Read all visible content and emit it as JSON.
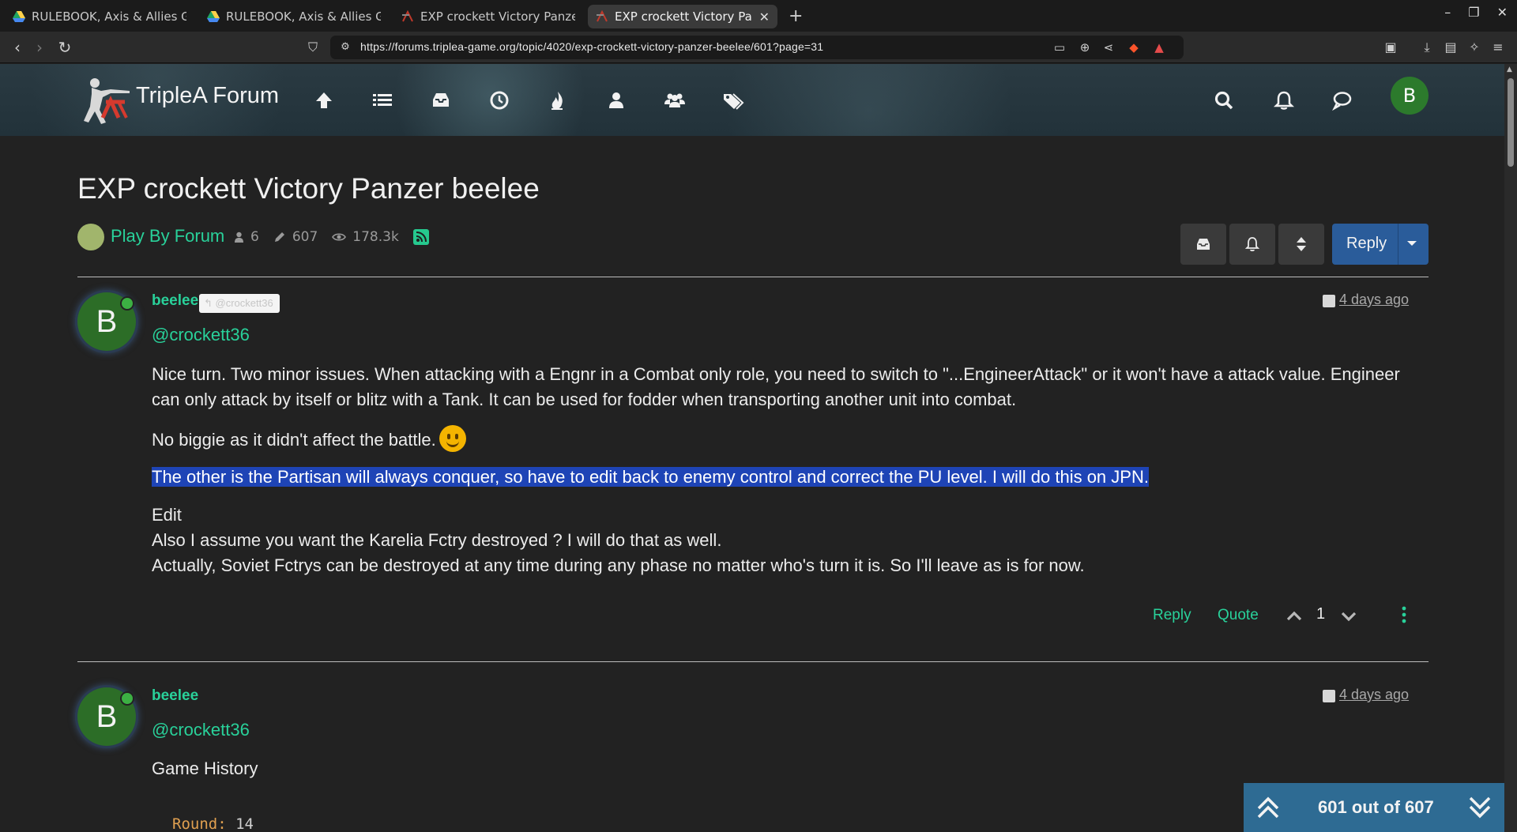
{
  "browser": {
    "tabs": [
      {
        "title": "RULEBOOK, Axis & Allies Glo",
        "favicon": "drive-icon",
        "active": false
      },
      {
        "title": "RULEBOOK, Axis & Allies Glo",
        "favicon": "drive-icon",
        "active": false
      },
      {
        "title": "EXP crockett Victory Panzer b",
        "favicon": "triplea-icon",
        "active": false
      },
      {
        "title": "EXP crockett Victory Panz",
        "favicon": "triplea-icon",
        "active": true
      }
    ],
    "new_tab": "+",
    "url": "https://forums.triplea-game.org/topic/4020/exp-crockett-victory-panzer-beelee/601?page=31"
  },
  "header": {
    "brand": "TripleA Forum",
    "nav_icons": [
      "arrow-up-icon",
      "list-icon",
      "inbox-icon",
      "clock-icon",
      "fire-icon",
      "user-icon",
      "users-icon",
      "tags-icon"
    ],
    "right_icons": [
      "search-icon",
      "bell-icon",
      "chat-icon"
    ],
    "avatar_letter": "B"
  },
  "topic": {
    "title": "EXP crockett Victory Panzer beelee",
    "category": "Play By Forum",
    "category_color": "#a1b56c",
    "posters": "6",
    "posts": "607",
    "views": "178.3k",
    "reply_label": "Reply"
  },
  "posts": [
    {
      "avatar": "B",
      "author": "beelee",
      "reply_to": "@crockett36",
      "time": "4 days ago",
      "mention": "@crockett36",
      "paragraphs": {
        "p1": "Nice turn. Two minor issues. When attacking with a Engnr in a Combat only role, you need to switch to \"...EngineerAttack\" or it won't have a attack value. Engineer can only attack by itself or blitz with a Tank. It can be used for fodder when transporting another unit into combat.",
        "p2": "No biggie as it didn't affect the battle.",
        "p3": "The other is the Partisan will always conquer, so have to edit back to enemy control and correct the PU level. I will do this on JPN.",
        "p4a": "Edit",
        "p4b": "Also I assume you want the Karelia Fctry destroyed ? I will do that as well.",
        "p4c": "Actually, Soviet Fctrys can be destroyed at any time during any phase no matter who's turn it is. So I'll leave as is for now."
      },
      "actions": {
        "reply": "Reply",
        "quote": "Quote",
        "votes": "1"
      }
    },
    {
      "avatar": "B",
      "author": "beelee",
      "time": "4 days ago",
      "mention": "@crockett36",
      "body": "Game History",
      "code_key": "Round:",
      "code_val": "14"
    }
  ],
  "pager": {
    "text": "601 out of 607"
  },
  "colors": {
    "accent": "#29d19a",
    "reply_button": "#2a5c9a",
    "highlight": "#1e44b6",
    "pager": "#2e6b93",
    "avatar": "#2c6d27"
  }
}
